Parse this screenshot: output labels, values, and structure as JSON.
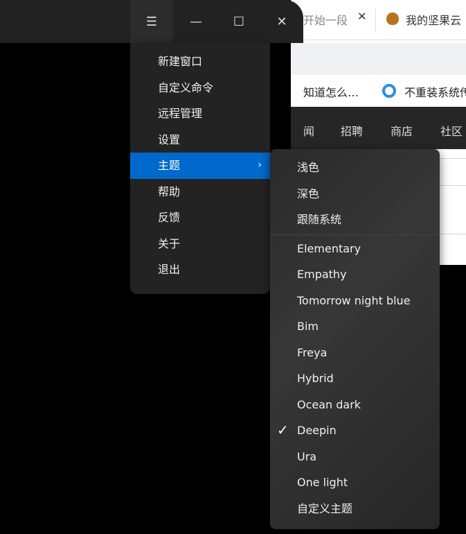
{
  "browser": {
    "tab1": "开始一段",
    "tab_close": "✕",
    "tab2": "我的坚果云",
    "bookmark1": "知道怎么…",
    "bookmark2": "不重装系统传",
    "nav": [
      "闻",
      "招聘",
      "商店",
      "社区"
    ]
  },
  "window": {
    "menu_icon": "☰",
    "minimize": "—",
    "maximize": "☐",
    "close": "✕"
  },
  "menu": {
    "items": [
      "新建窗口",
      "自定义命令",
      "远程管理",
      "设置",
      "主题",
      "帮助",
      "反馈",
      "关于",
      "退出"
    ],
    "active": "主题",
    "submenu_arrow": "›"
  },
  "theme_submenu": {
    "modes": [
      "浅色",
      "深色",
      "跟随系统"
    ],
    "themes": [
      "Elementary",
      "Empathy",
      "Tomorrow night blue",
      "Bim",
      "Freya",
      "Hybrid",
      "Ocean dark",
      "Deepin",
      "Ura",
      "One light",
      "自定义主题"
    ],
    "checked": "Deepin",
    "check_mark": "✓"
  }
}
